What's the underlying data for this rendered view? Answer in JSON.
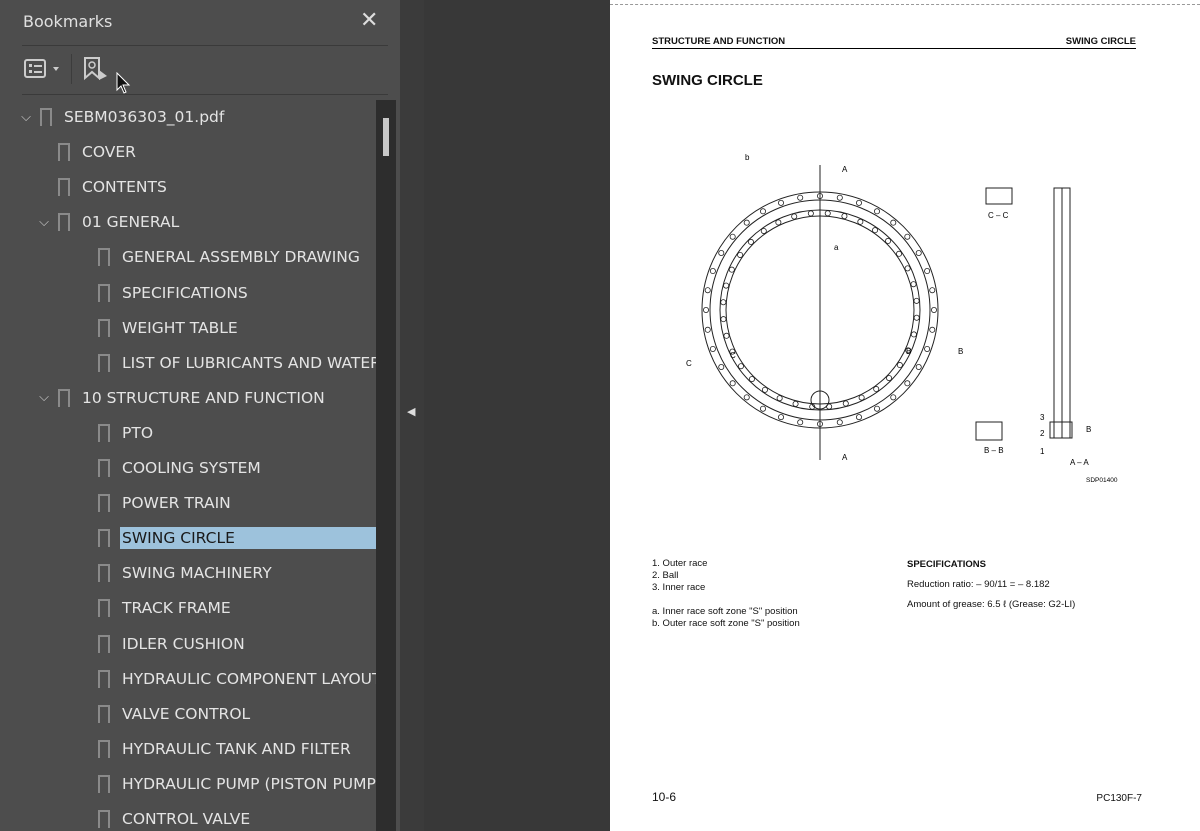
{
  "panel": {
    "title": "Bookmarks",
    "close_icon": "close-icon",
    "options_icon": "list-options-icon",
    "find_bookmark_icon": "bookmark-search-icon"
  },
  "bookmarks": [
    {
      "label": "SEBM036303_01.pdf",
      "level": 0,
      "expanded": true
    },
    {
      "label": "COVER",
      "level": 1
    },
    {
      "label": "CONTENTS",
      "level": 1
    },
    {
      "label": "01 GENERAL",
      "level": 1,
      "expanded": true
    },
    {
      "label": "GENERAL ASSEMBLY DRAWING",
      "level": 2
    },
    {
      "label": "SPECIFICATIONS",
      "level": 2
    },
    {
      "label": "WEIGHT TABLE",
      "level": 2
    },
    {
      "label": "LIST OF LUBRICANTS AND WATER",
      "level": 2
    },
    {
      "label": "10 STRUCTURE AND FUNCTION",
      "level": 1,
      "expanded": true
    },
    {
      "label": "PTO",
      "level": 2
    },
    {
      "label": "COOLING SYSTEM",
      "level": 2
    },
    {
      "label": "POWER TRAIN",
      "level": 2
    },
    {
      "label": "SWING CIRCLE",
      "level": 2,
      "selected": true
    },
    {
      "label": "SWING MACHINERY",
      "level": 2
    },
    {
      "label": "TRACK FRAME",
      "level": 2
    },
    {
      "label": "IDLER CUSHION",
      "level": 2
    },
    {
      "label": "HYDRAULIC COMPONENT LAYOUT",
      "level": 2
    },
    {
      "label": "VALVE CONTROL",
      "level": 2
    },
    {
      "label": "HYDRAULIC TANK AND FILTER",
      "level": 2
    },
    {
      "label": "HYDRAULIC PUMP (PISTON PUMP)",
      "level": 2
    },
    {
      "label": "CONTROL VALVE",
      "level": 2
    }
  ],
  "page": {
    "header_left": "STRUCTURE AND FUNCTION",
    "header_right": "SWING CIRCLE",
    "title": "SWING CIRCLE",
    "figure_code": "SDP01400",
    "figure_labels": {
      "a": "a",
      "b": "b",
      "A": "A",
      "B": "B",
      "C": "C",
      "cc": "C – C",
      "bb": "B – B",
      "aa": "A – A",
      "n1": "1",
      "n2": "2",
      "n3": "3"
    },
    "parts": [
      "1.  Outer race",
      "2.  Ball",
      "3.  Inner race"
    ],
    "notes": [
      "a.  Inner race soft zone \"S\" position",
      "b.  Outer race soft zone \"S\" position"
    ],
    "spec_title": "SPECIFICATIONS",
    "reduction": "Reduction ratio: – 90/11 = – 8.182",
    "grease": "Amount of grease: 6.5 ℓ (Grease: G2-LI)",
    "page_number": "10-6",
    "model": "PC130F-7"
  }
}
